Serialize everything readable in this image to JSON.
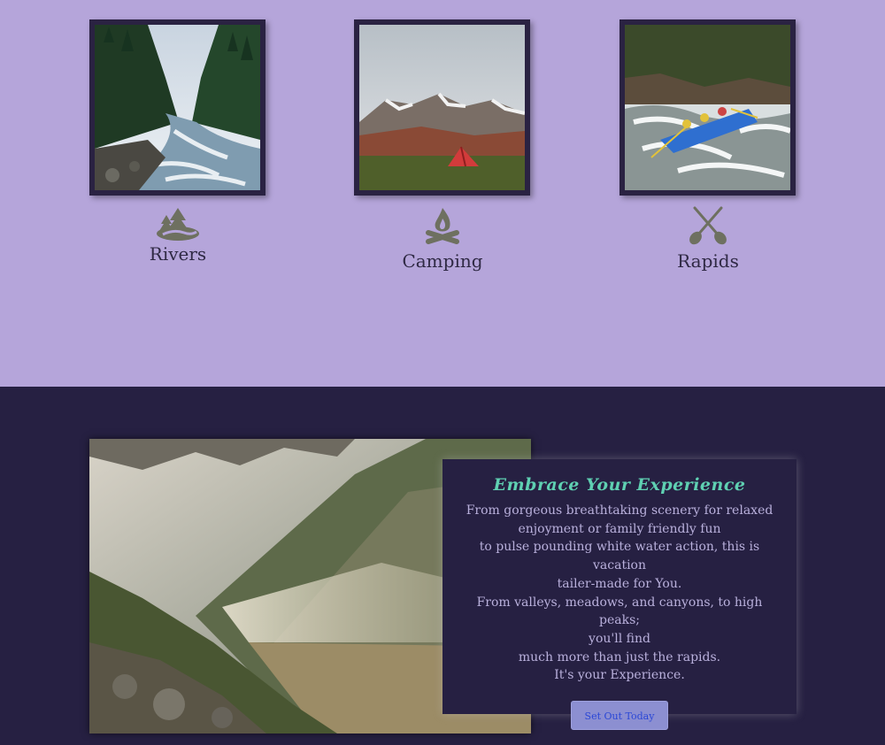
{
  "features": [
    {
      "label": "Rivers",
      "icon": "river-forest-icon"
    },
    {
      "label": "Camping",
      "icon": "campfire-icon"
    },
    {
      "label": "Rapids",
      "icon": "crossed-paddles-icon"
    }
  ],
  "experience": {
    "heading": "Embrace Your Experience",
    "lines": [
      "From gorgeous breathtaking scenery for relaxed",
      "enjoyment or family friendly fun",
      "to pulse pounding white water action, this is vacation",
      "tailer-made for You.",
      "From valleys, meadows, and canyons, to high peaks;",
      "you'll find",
      "much more than just the rapids.",
      "It's your Experience."
    ],
    "button_label": "Set Out Today"
  },
  "colors": {
    "top_background": "#b5a5da",
    "bottom_background": "#262042",
    "heading": "#5fd0b2",
    "button": "#8c8fd1"
  }
}
